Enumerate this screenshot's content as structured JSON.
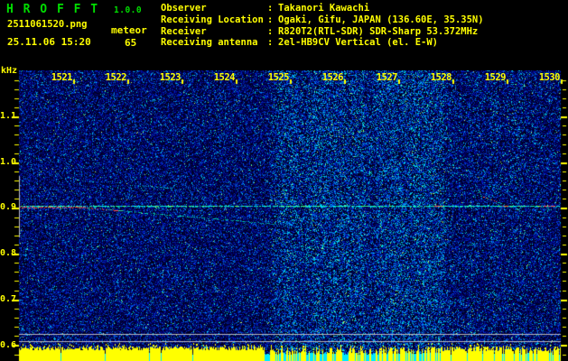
{
  "app": {
    "title": "H R O F F T",
    "version": "1.0.0"
  },
  "capture": {
    "filename": "2511061520.png",
    "mode": "meteor",
    "datetime": "25.11.06 15:20",
    "echo_count": "65"
  },
  "station": {
    "rows": [
      {
        "label": "Observer",
        "sep": ":",
        "value": "Takanori Kawachi"
      },
      {
        "label": "Receiving Location",
        "sep": ":",
        "value": "Ogaki, Gifu, JAPAN (136.60E, 35.35N)"
      },
      {
        "label": "Receiver",
        "sep": ":",
        "value": "R820T2(RTL-SDR) SDR-Sharp 53.372MHz"
      },
      {
        "label": "Receiving antenna",
        "sep": ":",
        "value": "2el-HB9CV Vertical (el. E-W)"
      }
    ]
  },
  "axis": {
    "unit": "kHz",
    "freq_labels": [
      "1.1",
      "1.0",
      "0.9",
      "0.8",
      "0.7",
      "0.6"
    ],
    "time_labels": [
      "1521",
      "1522",
      "1523",
      "1524",
      "1525",
      "1526",
      "1527",
      "1528",
      "1529",
      "1530"
    ],
    "carrier_freq_khz": "0.9"
  },
  "colors": {
    "title_green": "#00dd00",
    "text_yellow": "#ffff00",
    "tick_yellow": "#ffff00",
    "noise_navy": "#000060",
    "noise_cyan": "#00e0ff",
    "signal_yellow": "#ffff00",
    "base_cyan": "#00eaff",
    "marker_gray": "#b8b8c0",
    "echo_red": "#ff4455",
    "carrier_green": "#33ff88"
  }
}
